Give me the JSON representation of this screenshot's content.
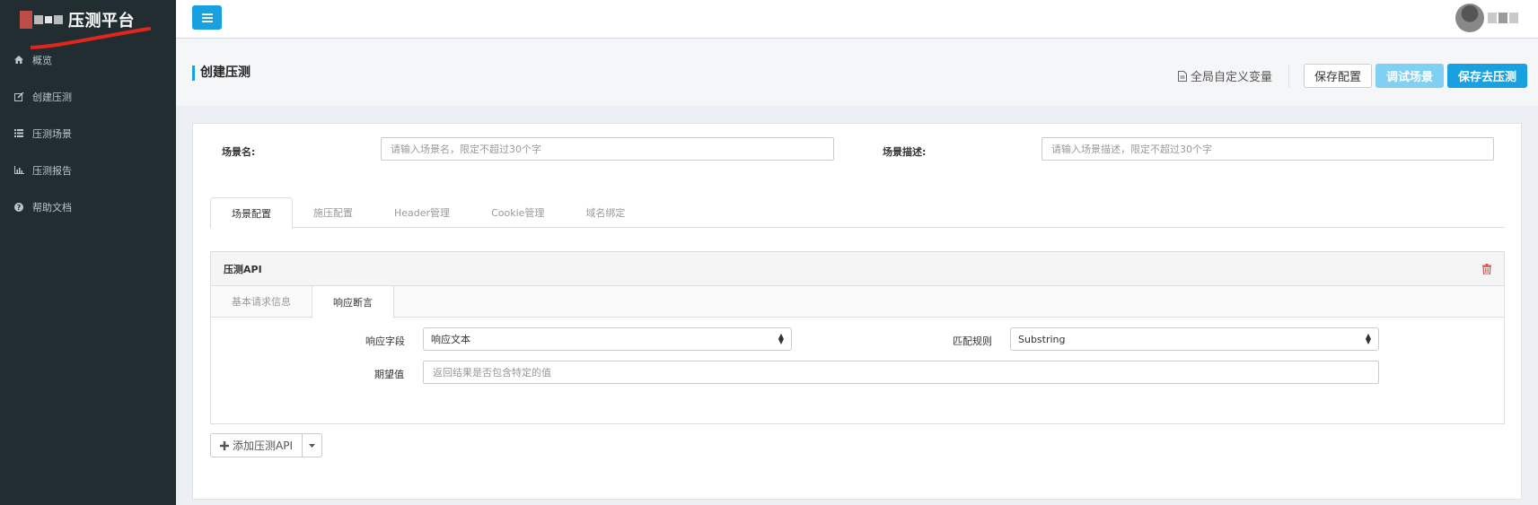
{
  "brand": {
    "title": "压测平台"
  },
  "sidebar": {
    "items": [
      {
        "label": "概览",
        "icon": "home-icon"
      },
      {
        "label": "创建压测",
        "icon": "edit-icon"
      },
      {
        "label": "压测场景",
        "icon": "list-icon"
      },
      {
        "label": "压测报告",
        "icon": "bar-chart-icon"
      },
      {
        "label": "帮助文档",
        "icon": "question-circle-icon"
      }
    ]
  },
  "page": {
    "title": "创建压测"
  },
  "actions": {
    "global_vars": "全局自定义变量",
    "save_config": "保存配置",
    "debug_scene": "调试场景",
    "save_and_test": "保存去压测"
  },
  "form": {
    "scene_name_label": "场景名:",
    "scene_name_placeholder": "请输入场景名，限定不超过30个字",
    "scene_desc_label": "场景描述:",
    "scene_desc_placeholder": "请输入场景描述，限定不超过30个字"
  },
  "tabs": [
    "场景配置",
    "施压配置",
    "Header管理",
    "Cookie管理",
    "域名绑定"
  ],
  "api": {
    "title": "压测API",
    "subtabs": [
      "基本请求信息",
      "响应断言"
    ],
    "response_field_label": "响应字段",
    "response_field_value": "响应文本",
    "match_rule_label": "匹配规则",
    "match_rule_value": "Substring",
    "expected_label": "期望值",
    "expected_placeholder": "返回结果是否包含特定的值"
  },
  "add_api": {
    "label": "添加压测API"
  },
  "colors": {
    "sidebar": "#222d32",
    "accent": "#18a0e0",
    "accent_light": "#7fd0f3",
    "danger": "#d9534f"
  }
}
